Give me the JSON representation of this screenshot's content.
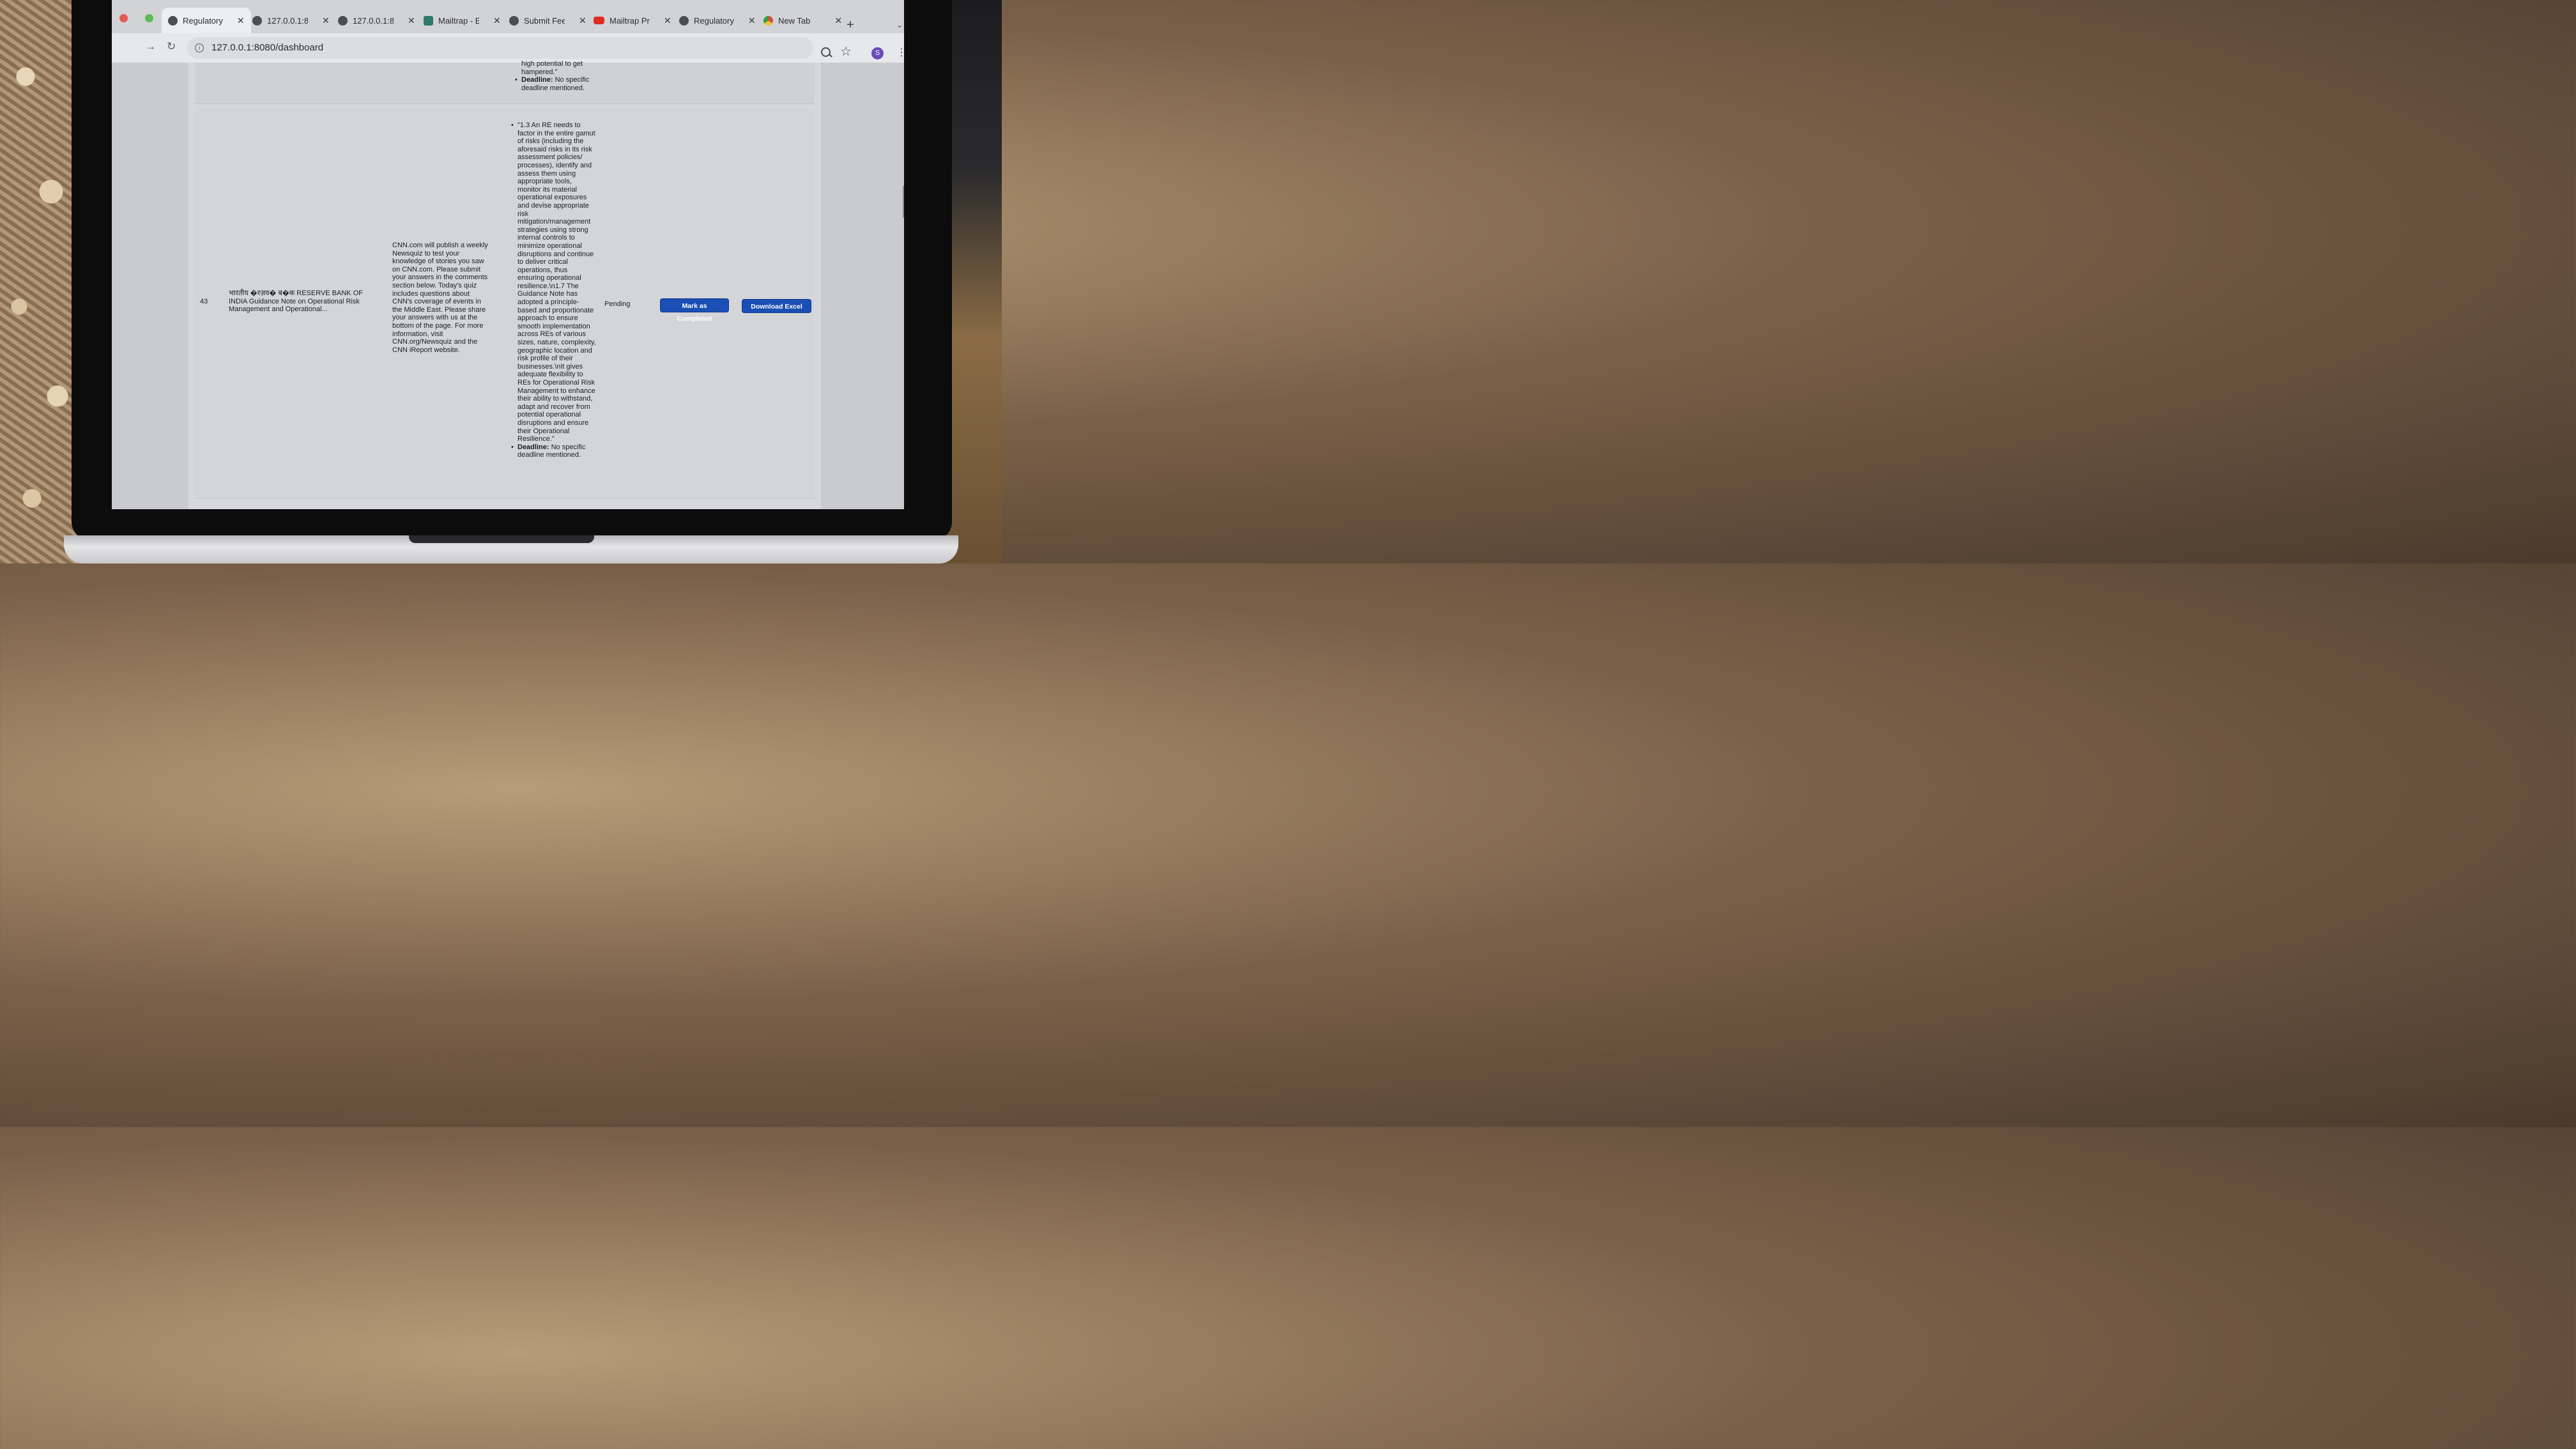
{
  "browser": {
    "tabs": [
      {
        "title": "Regulatory",
        "icon": "globe-icon",
        "active": true
      },
      {
        "title": "127.0.0.1:8",
        "icon": "globe-icon"
      },
      {
        "title": "127.0.0.1:8",
        "icon": "globe-icon"
      },
      {
        "title": "Mailtrap - E",
        "icon": "mailtrap-icon"
      },
      {
        "title": "Submit Fee",
        "icon": "globe-icon"
      },
      {
        "title": "Mailtrap Pr",
        "icon": "youtube-icon"
      },
      {
        "title": "Regulatory",
        "icon": "globe-icon"
      },
      {
        "title": "New Tab",
        "icon": "chrome-icon"
      }
    ],
    "url": "127.0.0.1:8080/dashboard",
    "profile_initial": "S"
  },
  "previous_row": {
    "action_points_tail": "high potential to get hampered.\"",
    "deadline_label": "Deadline:",
    "deadline_value": "No specific deadline mentioned."
  },
  "row": {
    "id": "43",
    "title": "भारतीय �रज़व� ब�क RESERVE BANK OF INDIA Guidance Note on Operational Risk Management and Operational...",
    "summary": "CNN.com will publish a weekly Newsquiz to test your knowledge of stories you saw on CNN.com. Please submit your answers in the comments section below. Today's quiz includes questions about CNN's coverage of events in the Middle East. Please share your answers with us at the bottom of the page. For more information, visit CNN.org/Newsquiz and the CNN iReport website.",
    "action_point": "\"1.3 An RE needs to factor in the entire gamut of risks (including the aforesaid risks in its risk assessment policies/ processes), identify and assess them using appropriate tools, monitor its material operational exposures and devise appropriate risk mitigation/management strategies using strong internal controls to minimize operational disruptions and continue to deliver critical operations, thus ensuring operational resilience.\\n1.7 The Guidance Note has adopted a principle-based and proportionate approach to ensure smooth implementation across REs of various sizes, nature, complexity, geographic location and risk profile of their businesses.\\nIt gives adequate flexibility to REs for Operational Risk Management to enhance their ability to withstand, adapt and recover from potential operational disruptions and ensure their Operational Resilience.\"",
    "deadline_label": "Deadline:",
    "deadline_value": "No specific deadline mentioned.",
    "status": "Pending",
    "mark_completed_label": "Mark as Completed",
    "download_label": "Download Excel"
  },
  "colors": {
    "button_bg": "#1b4fb5",
    "page_bg": "#d6d8db"
  }
}
